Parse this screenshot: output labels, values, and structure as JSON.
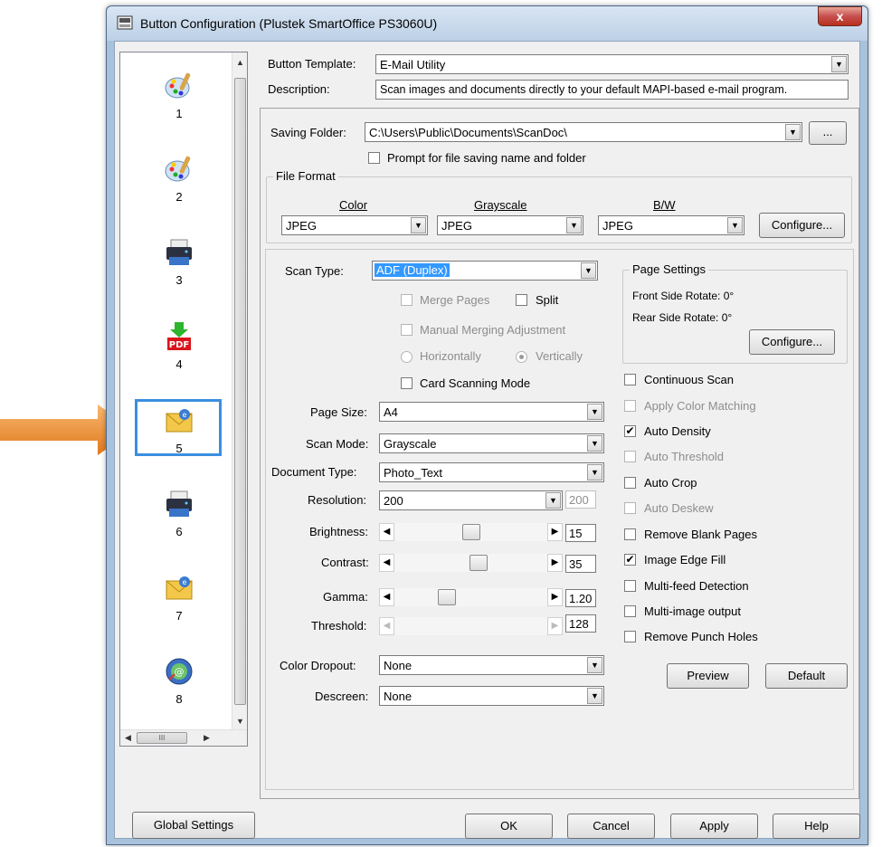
{
  "window": {
    "title": "Button Configuration (Plustek SmartOffice PS3060U)",
    "close_glyph": "x"
  },
  "button_list": {
    "items": [
      {
        "num": "1",
        "icon": "palette-icon"
      },
      {
        "num": "2",
        "icon": "palette-icon"
      },
      {
        "num": "3",
        "icon": "printer-icon"
      },
      {
        "num": "4",
        "icon": "pdf-icon"
      },
      {
        "num": "5",
        "icon": "email-icon"
      },
      {
        "num": "6",
        "icon": "printer-icon"
      },
      {
        "num": "7",
        "icon": "email-icon"
      },
      {
        "num": "8",
        "icon": "web-icon"
      }
    ],
    "selected": "5",
    "hscroll_grip": "III"
  },
  "header": {
    "template_label": "Button Template:",
    "template_value": "E-Mail Utility",
    "description_label": "Description:",
    "description_value": "Scan images and documents directly to your default MAPI-based e-mail program."
  },
  "saving": {
    "folder_label": "Saving Folder:",
    "folder_value": "C:\\Users\\Public\\Documents\\ScanDoc\\",
    "browse_label": "...",
    "prompt_label": "Prompt for file saving name and folder",
    "prompt_checked": false
  },
  "file_format": {
    "group_label": "File Format",
    "color_label": "Color",
    "color_value": "JPEG",
    "grayscale_label": "Grayscale",
    "grayscale_value": "JPEG",
    "bw_label": "B/W",
    "bw_value": "JPEG",
    "configure_label": "Configure..."
  },
  "scan": {
    "scan_type_label": "Scan Type:",
    "scan_type_value": "ADF (Duplex)",
    "merge_pages": "Merge Pages",
    "split": "Split",
    "manual_merging": "Manual Merging Adjustment",
    "horizontally": "Horizontally",
    "vertically": "Vertically",
    "card_scanning": "Card Scanning Mode",
    "page_size_label": "Page Size:",
    "page_size_value": "A4",
    "scan_mode_label": "Scan Mode:",
    "scan_mode_value": "Grayscale",
    "doc_type_label": "Document Type:",
    "doc_type_value": "Photo_Text",
    "resolution_label": "Resolution:",
    "resolution_value": "200",
    "resolution_custom": "200",
    "brightness_label": "Brightness:",
    "brightness_value": "15",
    "contrast_label": "Contrast:",
    "contrast_value": "35",
    "gamma_label": "Gamma:",
    "gamma_value": "1.20",
    "threshold_label": "Threshold:",
    "threshold_value": "128",
    "color_dropout_label": "Color Dropout:",
    "color_dropout_value": "None",
    "descreen_label": "Descreen:",
    "descreen_value": "None",
    "brightness_level": 0.5,
    "contrast_level": 0.56,
    "gamma_level": 0.32
  },
  "page_settings": {
    "group_label": "Page Settings",
    "front_rotate": "Front Side Rotate: 0°",
    "rear_rotate": "Rear Side Rotate: 0°",
    "configure_label": "Configure..."
  },
  "options": [
    {
      "label": "Continuous Scan",
      "checked": false,
      "enabled": true
    },
    {
      "label": "Apply Color Matching",
      "checked": false,
      "enabled": false
    },
    {
      "label": "Auto Density",
      "checked": true,
      "enabled": true
    },
    {
      "label": "Auto Threshold",
      "checked": false,
      "enabled": false
    },
    {
      "label": "Auto Crop",
      "checked": false,
      "enabled": true
    },
    {
      "label": "Auto Deskew",
      "checked": false,
      "enabled": false
    },
    {
      "label": "Remove Blank Pages",
      "checked": false,
      "enabled": true
    },
    {
      "label": "Image Edge Fill",
      "checked": true,
      "enabled": true
    },
    {
      "label": "Multi-feed Detection",
      "checked": false,
      "enabled": true
    },
    {
      "label": "Multi-image output",
      "checked": false,
      "enabled": true
    },
    {
      "label": "Remove Punch Holes",
      "checked": false,
      "enabled": true
    }
  ],
  "actions": {
    "preview": "Preview",
    "default": "Default",
    "global_settings": "Global Settings",
    "ok": "OK",
    "cancel": "Cancel",
    "apply": "Apply",
    "help": "Help"
  }
}
